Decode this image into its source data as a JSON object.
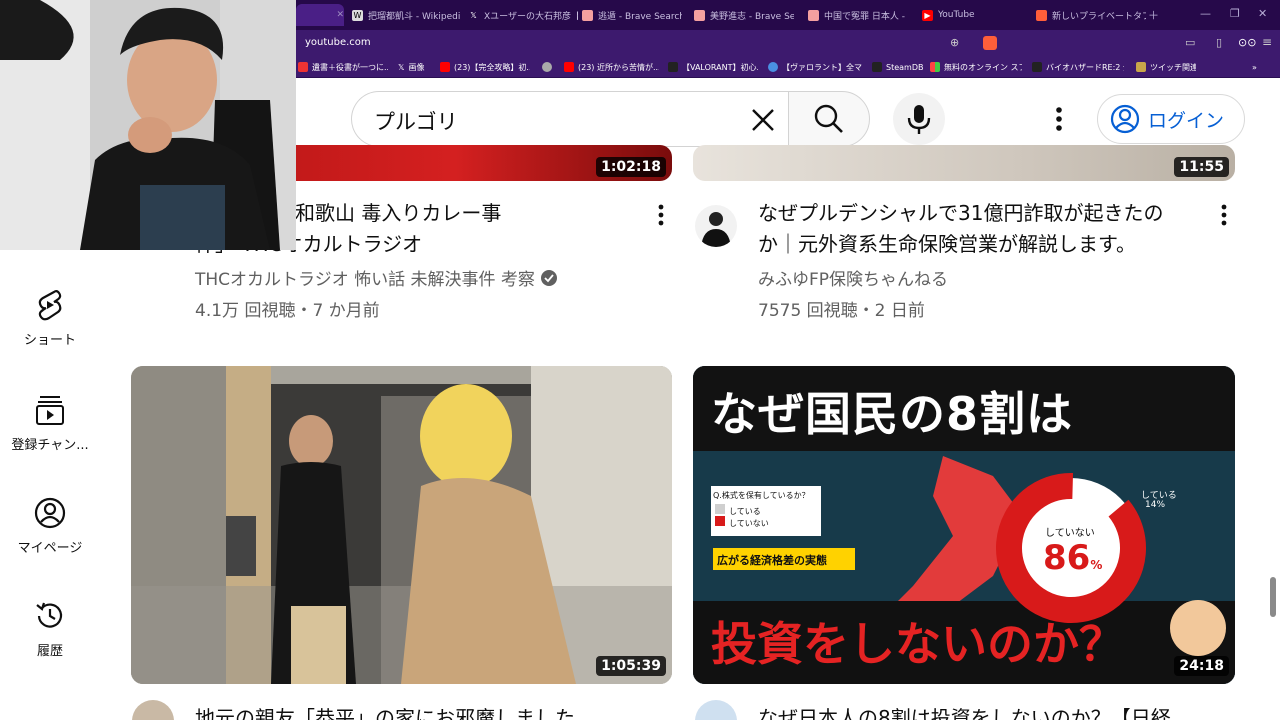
{
  "browser": {
    "url": "youtube.com",
    "tabs": [
      {
        "label": ""
      },
      {
        "label": "把瑠都凱斗 - Wikipedi..."
      },
      {
        "label": "Xユーザーの大石邦彦【C..."
      },
      {
        "label": "逃遁 - Brave Search"
      },
      {
        "label": "美野進志 - Brave Search"
      },
      {
        "label": "中国で冤罪 日本人 - ..."
      },
      {
        "label": "YouTube"
      },
      {
        "label": "新しいプライベートタブ"
      }
    ],
    "bookmarks": [
      {
        "label": "遺書＋役書が一つに..."
      },
      {
        "label": "画像"
      },
      {
        "label": "(23)【完全攻略】初..."
      },
      {
        "label": ""
      },
      {
        "label": "(23) 近所から苦情が..."
      },
      {
        "label": "【VALORANT】初心..."
      },
      {
        "label": "【ヴァロラント】全マップ..."
      },
      {
        "label": "SteamDB"
      },
      {
        "label": "無料のオンライン スプ..."
      },
      {
        "label": "バイオハザードRE:2 全..."
      },
      {
        "label": "ツイッチ関連"
      }
    ]
  },
  "header": {
    "search_value": "プルゴリ",
    "login_label": "ログイン"
  },
  "sidebar": {
    "items": [
      {
        "label": "ショート"
      },
      {
        "label": "登録チャン..."
      },
      {
        "label": "マイページ"
      },
      {
        "label": "履歴"
      }
    ]
  },
  "videos": [
    {
      "title": "件紹介！「和歌山 毒入りカレー事件」 THCオカルトラジオ",
      "title_line1": "件紹介！「和歌山 毒入りカレー事",
      "title_line2": "件」 THCオカルトラジオ",
      "channel": "THCオカルトラジオ 怖い話 未解決事件 考察",
      "meta": "4.1万 回視聴・7 か月前",
      "duration": "1:02:18"
    },
    {
      "title": "なぜプルデンシャルで31億円詐取が起きたのか｜元外資系生命保険営業が解説します。",
      "title_line1": "なぜプルデンシャルで31億円詐取が起きたの",
      "title_line2": "か｜元外資系生命保険営業が解説します。",
      "channel": "みふゆFP保険ちゃんねる",
      "meta": "7575 回視聴・2 日前",
      "duration": "11:55"
    },
    {
      "title": "地元の親友「恭平」の家にお邪魔しました",
      "duration": "1:05:39"
    },
    {
      "title": "なぜ日本人の8割は投資をしないのか？【日経",
      "duration": "24:18",
      "thumb_text": {
        "top": "なぜ国民の8割は",
        "bottom": "投資をしないのか？",
        "question": "Q.株式を保有しているか？",
        "legend_yes": "している",
        "legend_no": "していない",
        "subtitle": "広がる経済格差の実態",
        "pie_label": "していない",
        "pie_value": "86",
        "pie_unit": "%",
        "pie_small_label": "している",
        "pie_small_value": "14%"
      }
    }
  ],
  "colors": {
    "tab_bg": "#26094a",
    "toolbar_bg": "#3d1a6e",
    "link_blue": "#065fd4",
    "thumb_red": "#d81a1a",
    "thumb_yellow": "#ffd200"
  }
}
